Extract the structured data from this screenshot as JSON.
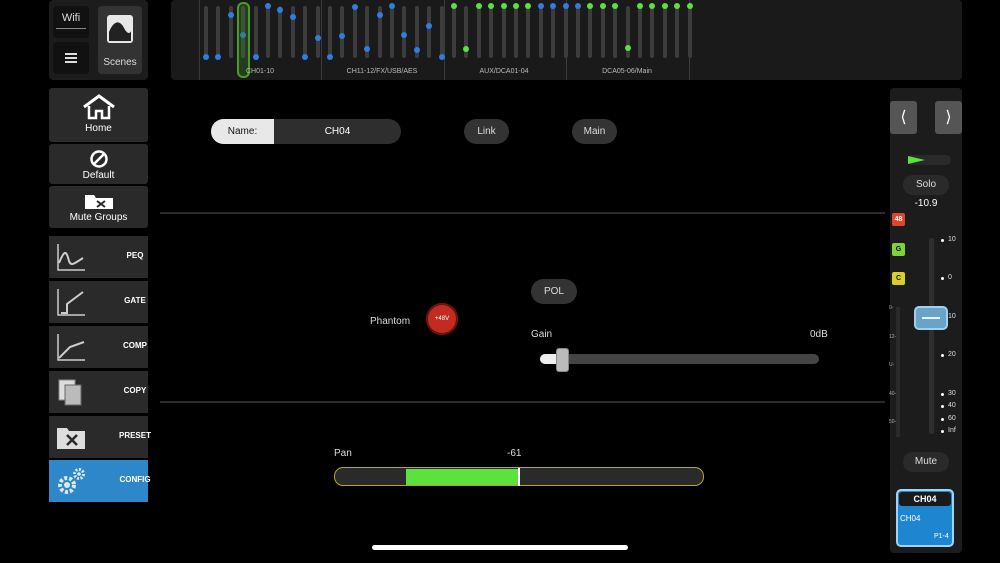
{
  "topbar": {
    "wifi_label": "Wifi",
    "scenes_label": "Scenes"
  },
  "overview": {
    "groups": [
      "CH01-10",
      "CH11-12/FX/USB/AES",
      "AUX/DCA01-04",
      "DCA05-06/Main"
    ],
    "selected_index": 3,
    "faders": [
      {
        "level": 0.02,
        "color": "#2f7de0"
      },
      {
        "level": 0.02,
        "color": "#2f7de0"
      },
      {
        "level": 0.82,
        "color": "#2f7de0"
      },
      {
        "level": 0.45,
        "color": "#2f7de0"
      },
      {
        "level": 0.02,
        "color": "#2f7de0"
      },
      {
        "level": 1.0,
        "color": "#2f7de0"
      },
      {
        "level": 0.93,
        "color": "#2f7de0"
      },
      {
        "level": 0.78,
        "color": "#2f7de0"
      },
      {
        "level": 0.02,
        "color": "#2f7de0"
      },
      {
        "level": 0.38,
        "color": "#2f7de0"
      },
      {
        "level": 0.02,
        "color": "#2f7de0"
      },
      {
        "level": 0.42,
        "color": "#2f7de0"
      },
      {
        "level": 0.98,
        "color": "#2f7de0"
      },
      {
        "level": 0.18,
        "color": "#2f7de0"
      },
      {
        "level": 0.82,
        "color": "#2f7de0"
      },
      {
        "level": 1.0,
        "color": "#2f7de0"
      },
      {
        "level": 0.45,
        "color": "#2f7de0"
      },
      {
        "level": 0.15,
        "color": "#2f7de0"
      },
      {
        "level": 0.62,
        "color": "#2f7de0"
      },
      {
        "level": 0.02,
        "color": "#2f7de0"
      },
      {
        "level": 1.0,
        "color": "#5be23d"
      },
      {
        "level": 0.18,
        "color": "#5be23d"
      },
      {
        "level": 1.0,
        "color": "#5be23d"
      },
      {
        "level": 1.0,
        "color": "#5be23d"
      },
      {
        "level": 1.0,
        "color": "#5be23d"
      },
      {
        "level": 1.0,
        "color": "#5be23d"
      },
      {
        "level": 1.0,
        "color": "#5be23d"
      },
      {
        "level": 1.0,
        "color": "#2f7de0"
      },
      {
        "level": 1.0,
        "color": "#2f7de0"
      },
      {
        "level": 1.0,
        "color": "#2f7de0"
      },
      {
        "level": 1.0,
        "color": "#2f7de0"
      },
      {
        "level": 1.0,
        "color": "#5be23d"
      },
      {
        "level": 1.0,
        "color": "#5be23d"
      },
      {
        "level": 1.0,
        "color": "#5be23d"
      },
      {
        "level": 0.2,
        "color": "#5be23d"
      },
      {
        "level": 1.0,
        "color": "#5be23d"
      },
      {
        "level": 1.0,
        "color": "#5be23d"
      },
      {
        "level": 1.0,
        "color": "#5be23d"
      },
      {
        "level": 1.0,
        "color": "#5be23d"
      },
      {
        "level": 1.0,
        "color": "#5be23d"
      }
    ]
  },
  "nav": {
    "home": "Home",
    "default": "Default",
    "mute_groups": "Mute Groups",
    "items": [
      {
        "label": "PEQ",
        "icon": "peq-icon"
      },
      {
        "label": "GATE",
        "icon": "gate-icon"
      },
      {
        "label": "COMP",
        "icon": "comp-icon"
      },
      {
        "label": "COPY",
        "icon": "copy-icon"
      },
      {
        "label": "PRESET",
        "icon": "preset-icon"
      },
      {
        "label": "CONFIG",
        "icon": "config-icon",
        "active": true
      }
    ]
  },
  "config": {
    "name_label": "Name:",
    "name_value": "CH04",
    "link_label": "Link",
    "main_label": "Main",
    "pol_label": "POL",
    "phantom_label": "Phantom",
    "phantom_button": "+48V",
    "phantom_on": true,
    "gain_label": "Gain",
    "gain_value": "0dB",
    "gain_fraction": 0.08,
    "pan_label": "Pan",
    "pan_value": "-61"
  },
  "strip": {
    "prev_label": "⟨",
    "next_label": "⟩",
    "solo_label": "Solo",
    "level": "-10.9",
    "badge_48": "48",
    "badge_g": "G",
    "badge_c": "C",
    "meter_labels": [
      "0-",
      "12-",
      "U-",
      "40-",
      "50-"
    ],
    "fader_scale": [
      "10",
      "0",
      "10",
      "20",
      "30",
      "40",
      "60",
      "Inf"
    ],
    "mute_label": "Mute",
    "channel_id": "CH04",
    "channel_name": "CH04",
    "channel_patch": "P1-4",
    "colors": {
      "badge_48": "#e0452a",
      "badge_g": "#7ed33a",
      "badge_c": "#d8cf2e",
      "accent": "#1e86d0"
    }
  }
}
